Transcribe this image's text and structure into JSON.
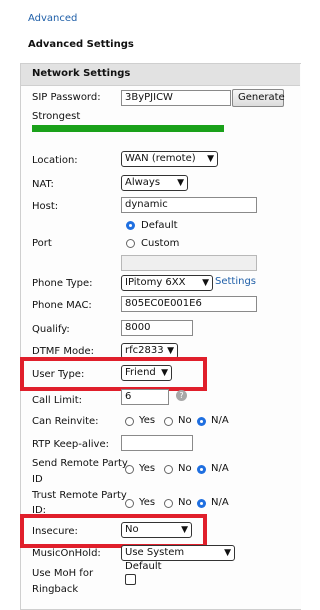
{
  "top_link": "Advanced",
  "section_heading": "Advanced Settings",
  "panel_title": "Network Settings",
  "sip_password": {
    "label": "SIP Password:",
    "value": "3ByPJICW",
    "button": "Generate"
  },
  "strength": {
    "label": "Strongest",
    "color": "#1aa11a",
    "level": 1.0
  },
  "location": {
    "label": "Location:",
    "value": "WAN (remote)"
  },
  "nat": {
    "label": "NAT:",
    "value": "Always"
  },
  "host": {
    "label": "Host:",
    "value": "dynamic"
  },
  "port": {
    "label": "Port",
    "option_default": "Default",
    "option_custom": "Custom",
    "selected": "Default"
  },
  "phone_type": {
    "label": "Phone Type:",
    "value": "IPitomy 6XX",
    "settings_link": "Settings"
  },
  "phone_mac": {
    "label": "Phone MAC:",
    "value": "805EC0E001E6"
  },
  "qualify": {
    "label": "Qualify:",
    "value": "8000"
  },
  "dtmf_mode": {
    "label": "DTMF Mode:",
    "value": "rfc2833"
  },
  "user_type": {
    "label": "User Type:",
    "value": "Friend"
  },
  "call_limit": {
    "label": "Call Limit:",
    "value": "6",
    "help_icon": "?"
  },
  "can_reinvite": {
    "label": "Can Reinvite:",
    "yes": "Yes",
    "no": "No",
    "na": "N/A",
    "selected": "N/A"
  },
  "rtp_keepalive": {
    "label": "RTP Keep-alive:",
    "value": ""
  },
  "send_remote_party_id": {
    "label_line1": "Send Remote Party",
    "label_line2": "ID",
    "yes": "Yes",
    "no": "No",
    "na": "N/A",
    "selected": "N/A"
  },
  "trust_remote_party_id": {
    "label_line1": "Trust Remote Party",
    "label_line2": "ID:",
    "yes": "Yes",
    "no": "No",
    "na": "N/A",
    "selected": "N/A"
  },
  "insecure": {
    "label": "Insecure:",
    "value": "No"
  },
  "music_on_hold": {
    "label": "MusicOnHold:",
    "value": "Use System Default"
  },
  "use_moh_ringback": {
    "label_line1": "Use MoH for",
    "label_line2": "Ringback",
    "checked": false
  },
  "highlight_color": "#e01f2b"
}
